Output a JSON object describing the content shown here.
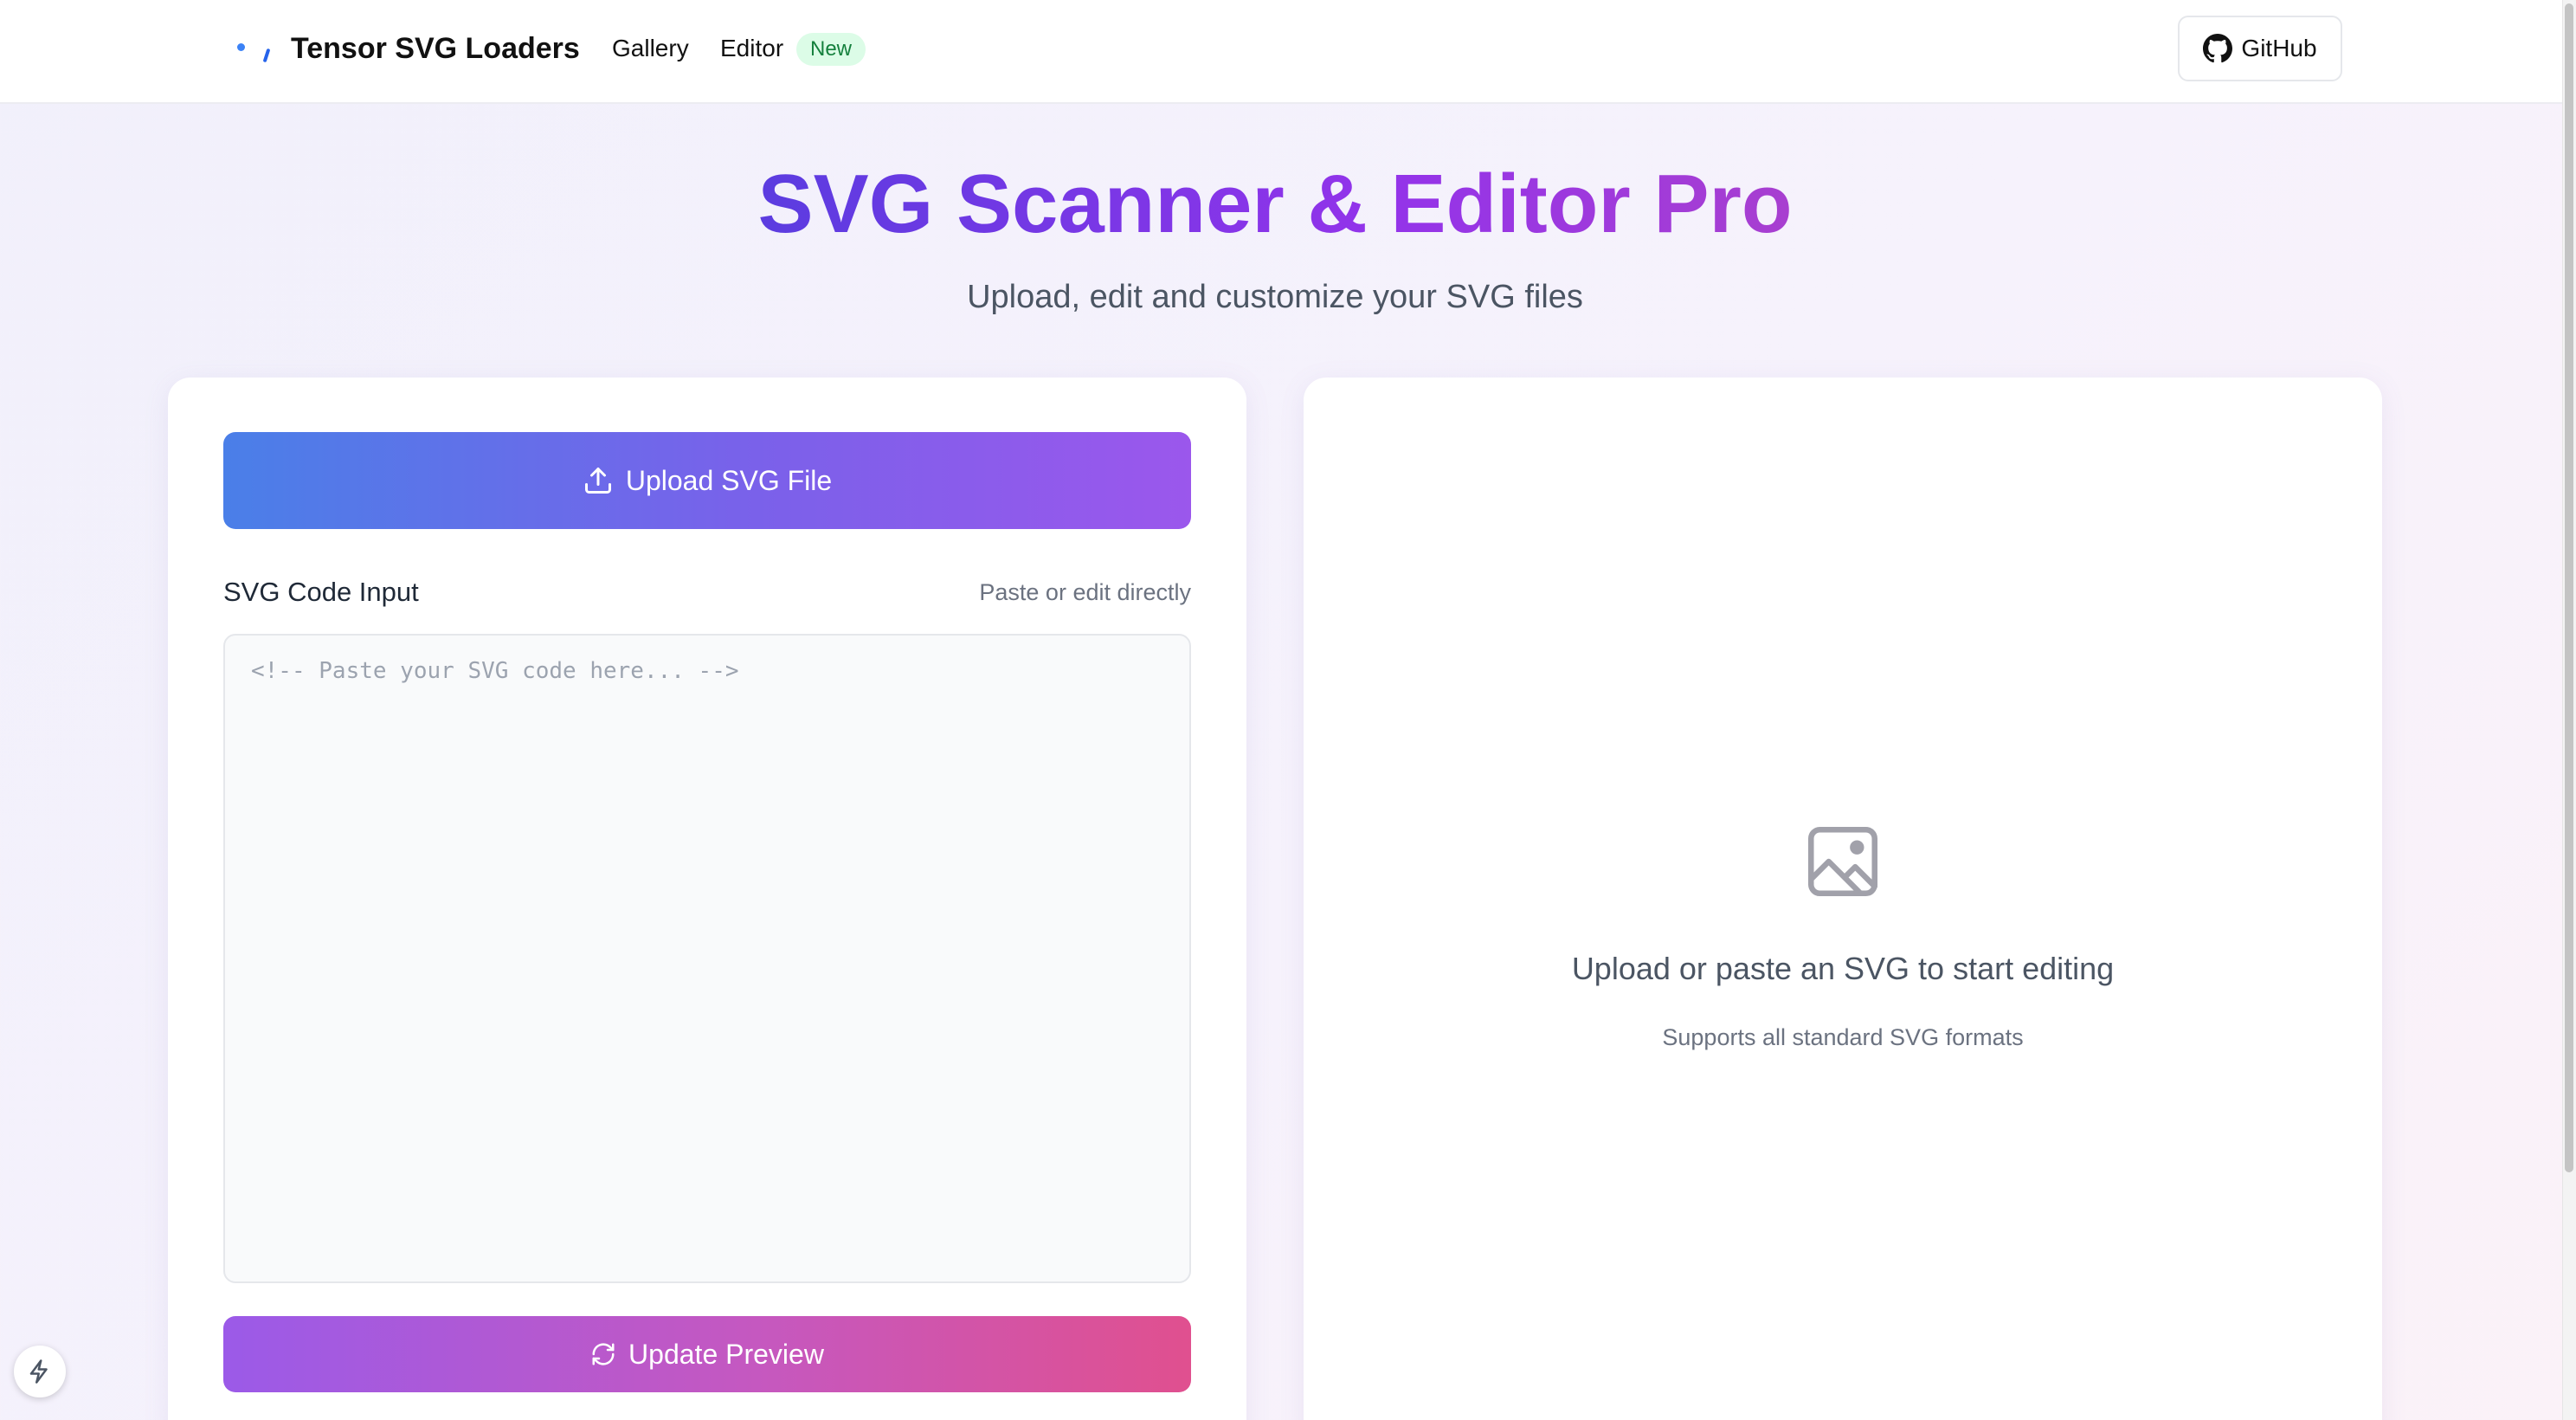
{
  "header": {
    "brand": "Tensor SVG Loaders",
    "nav": {
      "gallery": "Gallery",
      "editor": "Editor",
      "editor_badge": "New"
    },
    "github_label": "GitHub"
  },
  "hero": {
    "title": "SVG Scanner & Editor Pro",
    "subtitle": "Upload, edit and customize your SVG files"
  },
  "editor_panel": {
    "upload_button": "Upload SVG File",
    "code_label": "SVG Code Input",
    "code_hint": "Paste or edit directly",
    "code_placeholder": "<!-- Paste your SVG code here... -->",
    "code_value": "",
    "update_button": "Update Preview"
  },
  "preview_panel": {
    "empty_title": "Upload or paste an SVG to start editing",
    "empty_subtitle": "Supports all standard SVG formats"
  },
  "colors": {
    "accent_blue": "#4a7fe8",
    "accent_purple": "#9b57ec",
    "accent_pink": "#e0508f",
    "badge_green": "#15803d"
  },
  "icons": {
    "upload": "upload-icon",
    "refresh": "refresh-icon",
    "image": "image-icon",
    "github": "github-icon",
    "dev_indicator": "lightning-icon"
  }
}
